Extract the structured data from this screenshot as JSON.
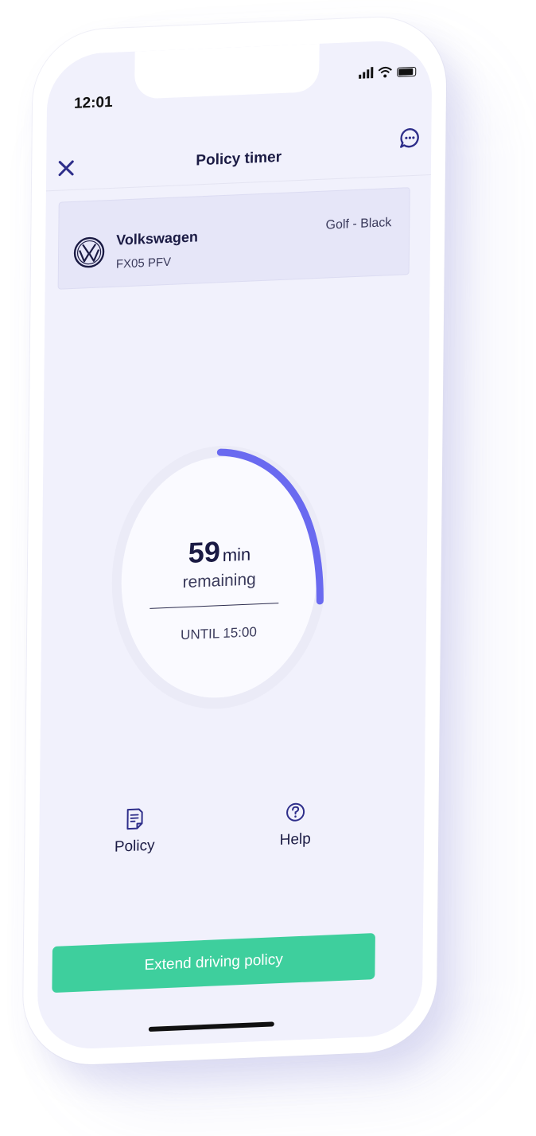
{
  "status_bar": {
    "time": "12:01"
  },
  "header": {
    "title": "Policy timer",
    "close_icon": "close-icon",
    "chat_icon": "chat-icon"
  },
  "vehicle": {
    "make": "Volkswagen",
    "plate": "FX05 PFV",
    "model_color": "Golf - Black",
    "logo_icon": "vw-logo"
  },
  "timer": {
    "value": "59",
    "unit": "min",
    "remaining_label": "remaining",
    "until_label": "UNTIL 15:00",
    "progress_fraction": 0.22
  },
  "actions": [
    {
      "label": "Policy",
      "icon": "document-icon"
    },
    {
      "label": "Help",
      "icon": "help-icon"
    }
  ],
  "extend_button": {
    "label": "Extend driving policy"
  },
  "colors": {
    "accent": "#6a6af0",
    "primary_button": "#3ecf9d",
    "screen_background": "#f1f1fc",
    "text_dark": "#1b1b44"
  }
}
